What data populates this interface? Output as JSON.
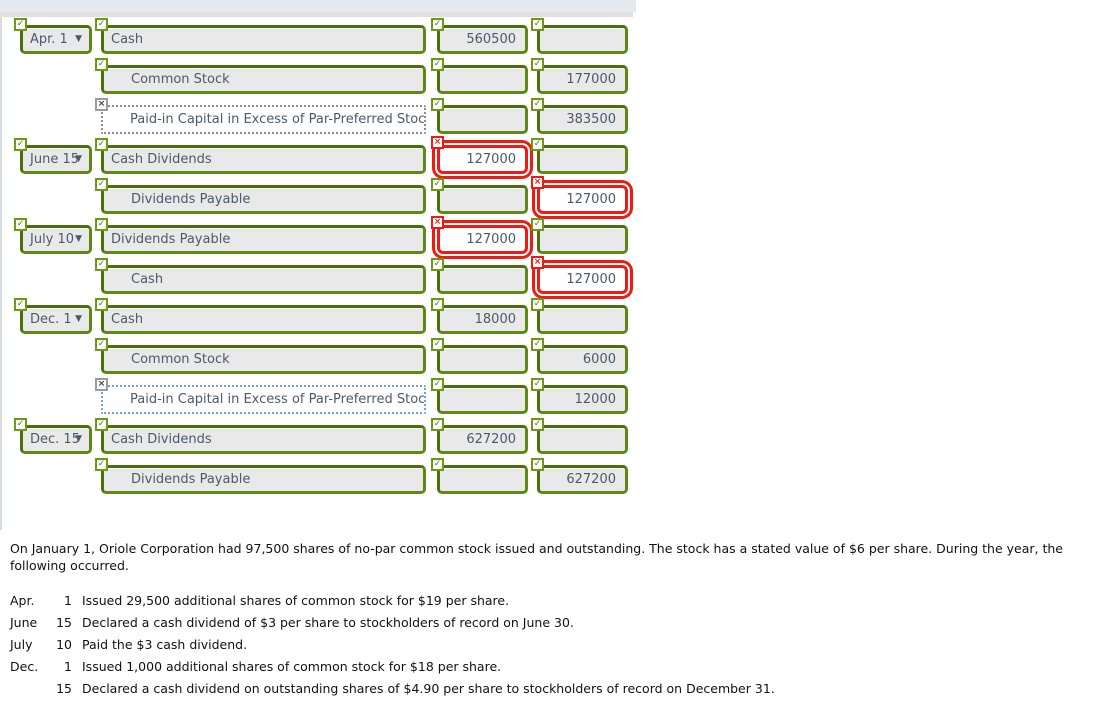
{
  "window": {
    "top_strip_color": "#e4e9ee",
    "secondary_strip_color": "#e0e0e0"
  },
  "journal": {
    "field_border_color": "#4f7a0e",
    "field_fill_color": "#e9e9e9",
    "error_color": "#ee1b13",
    "badge_ok_icon": "check-icon",
    "badge_error_icon": "x-icon",
    "rows": [
      {
        "date": "Apr. 1",
        "date_status": "ok",
        "account": "Cash",
        "account_status": "ok",
        "account_state": "normal",
        "indent": false,
        "debit": "560500",
        "debit_status": "ok",
        "debit_state": "normal",
        "credit": "",
        "credit_status": "ok",
        "credit_state": "normal"
      },
      {
        "date": "",
        "date_status": "none",
        "account": "Common Stock",
        "account_status": "ok",
        "account_state": "normal",
        "indent": true,
        "debit": "",
        "debit_status": "ok",
        "debit_state": "normal",
        "credit": "177000",
        "credit_status": "ok",
        "credit_state": "normal"
      },
      {
        "date": "",
        "date_status": "none",
        "account": "Paid-in Capital in Excess of Par-Preferred Stock",
        "account_status": "gray",
        "account_state": "dotted",
        "indent": true,
        "debit": "",
        "debit_status": "ok",
        "debit_state": "normal",
        "credit": "383500",
        "credit_status": "ok",
        "credit_state": "normal"
      },
      {
        "date": "June 15",
        "date_status": "ok",
        "account": "Cash Dividends",
        "account_status": "ok",
        "account_state": "normal",
        "indent": false,
        "debit": "127000",
        "debit_status": "bad",
        "debit_state": "error",
        "credit": "",
        "credit_status": "ok",
        "credit_state": "normal"
      },
      {
        "date": "",
        "date_status": "none",
        "account": "Dividends Payable",
        "account_status": "ok",
        "account_state": "normal",
        "indent": true,
        "debit": "",
        "debit_status": "ok",
        "debit_state": "normal",
        "credit": "127000",
        "credit_status": "bad",
        "credit_state": "error"
      },
      {
        "date": "July 10",
        "date_status": "ok",
        "account": "Dividends Payable",
        "account_status": "ok",
        "account_state": "normal",
        "indent": false,
        "debit": "127000",
        "debit_status": "bad",
        "debit_state": "error",
        "credit": "",
        "credit_status": "ok",
        "credit_state": "normal"
      },
      {
        "date": "",
        "date_status": "none",
        "account": "Cash",
        "account_status": "ok",
        "account_state": "normal",
        "indent": true,
        "debit": "",
        "debit_status": "ok",
        "debit_state": "normal",
        "credit": "127000",
        "credit_status": "bad",
        "credit_state": "error"
      },
      {
        "date": "Dec. 1",
        "date_status": "ok",
        "account": "Cash",
        "account_status": "ok",
        "account_state": "normal",
        "indent": false,
        "debit": "18000",
        "debit_status": "ok",
        "debit_state": "normal",
        "credit": "",
        "credit_status": "ok",
        "credit_state": "normal"
      },
      {
        "date": "",
        "date_status": "none",
        "account": "Common Stock",
        "account_status": "ok",
        "account_state": "normal",
        "indent": true,
        "debit": "",
        "debit_status": "ok",
        "debit_state": "normal",
        "credit": "6000",
        "credit_status": "ok",
        "credit_state": "normal"
      },
      {
        "date": "",
        "date_status": "none",
        "account": "Paid-in Capital in Excess of Par-Preferred Stock",
        "account_status": "gray",
        "account_state": "dotted-blue",
        "indent": true,
        "debit": "",
        "debit_status": "ok",
        "debit_state": "normal",
        "credit": "12000",
        "credit_status": "ok",
        "credit_state": "normal"
      },
      {
        "date": "Dec. 15",
        "date_status": "ok",
        "account": "Cash Dividends",
        "account_status": "ok",
        "account_state": "normal",
        "indent": false,
        "debit": "627200",
        "debit_status": "ok",
        "debit_state": "normal",
        "credit": "",
        "credit_status": "ok",
        "credit_state": "normal"
      },
      {
        "date": "",
        "date_status": "none",
        "account": "Dividends Payable",
        "account_status": "ok",
        "account_state": "normal",
        "indent": true,
        "debit": "",
        "debit_status": "ok",
        "debit_state": "normal",
        "credit": "627200",
        "credit_status": "ok",
        "credit_state": "normal"
      }
    ]
  },
  "narrative": {
    "intro": "On January 1, Oriole Corporation had 97,500 shares of no-par common stock issued and outstanding. The stock has a stated value of $6 per share. During the year, the following occurred.",
    "events": [
      {
        "month": "Apr.",
        "day": "1",
        "desc": "Issued 29,500 additional shares of common stock for $19 per share."
      },
      {
        "month": "June",
        "day": "15",
        "desc": "Declared a cash dividend of $3 per share to stockholders of record on June 30."
      },
      {
        "month": "July",
        "day": "10",
        "desc": "Paid the $3 cash dividend."
      },
      {
        "month": "Dec.",
        "day": "1",
        "desc": "Issued 1,000 additional shares of common stock for $18 per share."
      },
      {
        "month": "",
        "day": "15",
        "desc": "Declared a cash dividend on outstanding shares of $4.90 per share to stockholders of record on December 31."
      }
    ]
  }
}
